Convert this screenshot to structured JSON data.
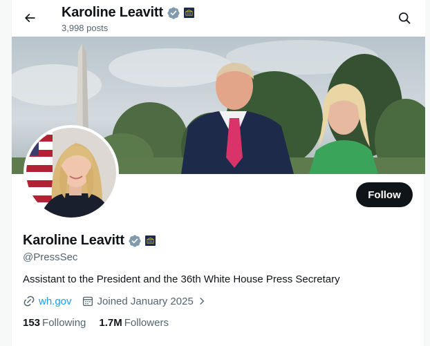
{
  "header": {
    "display_name": "Karoline Leavitt",
    "post_count": "3,998 posts"
  },
  "profile": {
    "display_name": "Karoline Leavitt",
    "handle": "@PressSec",
    "bio": "Assistant to the President and the 36th White House Press Secretary",
    "website": "wh.gov",
    "joined": "Joined January 2025",
    "following_count": "153",
    "following_label": "Following",
    "followers_count": "1.7M",
    "followers_label": "Followers"
  },
  "actions": {
    "follow_label": "Follow"
  },
  "icons": {
    "back": "arrow-left-icon",
    "search": "search-icon",
    "verified": "verified-badge-icon",
    "affiliation": "government-affiliation-icon",
    "link": "link-icon",
    "calendar": "calendar-icon",
    "more": "chevron-right-icon"
  },
  "colors": {
    "accent": "#1d9bf0",
    "text_primary": "#0f1419",
    "text_secondary": "#536471",
    "verified_gray": "#829aab",
    "affiliation_navy": "#1c2a52",
    "follow_bg": "#0f1419"
  }
}
